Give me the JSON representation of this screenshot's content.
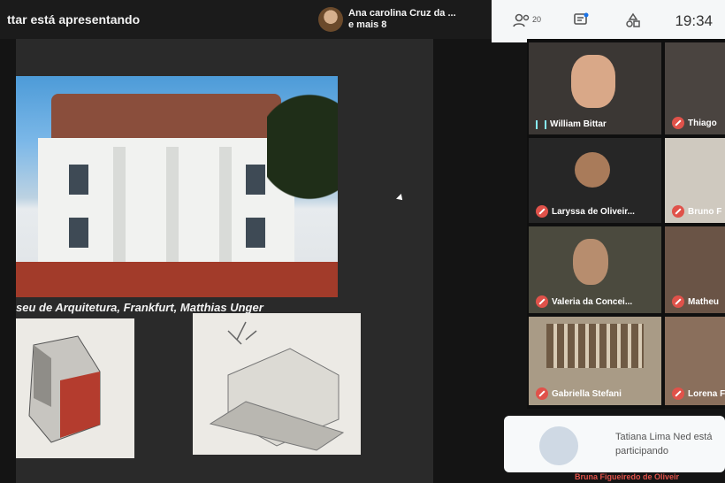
{
  "presenter": {
    "text": "ttar está apresentando"
  },
  "joined": {
    "line1": "Ana carolina Cruz da ...",
    "line2": "e mais 8"
  },
  "toolbar": {
    "people_icon": "people-icon",
    "people_count": "20",
    "chat_icon": "chat-icon",
    "activities_icon": "activities-icon",
    "time": "19:34"
  },
  "slide": {
    "caption": "seu de Arquitetura, Frankfurt, Matthias Unger"
  },
  "participants": [
    {
      "name": "William Bittar",
      "muted": false
    },
    {
      "name": "Thiago",
      "muted": true
    },
    {
      "name": "Laryssa de Oliveir...",
      "muted": true
    },
    {
      "name": "Bruno F",
      "muted": true
    },
    {
      "name": "Valeria da Concei...",
      "muted": true
    },
    {
      "name": "Matheu",
      "muted": true
    },
    {
      "name": "Gabriella Stefani",
      "muted": true
    },
    {
      "name": "Lorena F",
      "muted": true
    }
  ],
  "toast": {
    "message": "Tatiana Lima Ned está participando"
  },
  "bottom_partial": {
    "name": "Bruna Figueiredo de Oliveir"
  },
  "colors": {
    "muted_red": "#e0524a",
    "topbar": "#1b1b1b",
    "toolbar_bg": "#f5f7f8"
  }
}
